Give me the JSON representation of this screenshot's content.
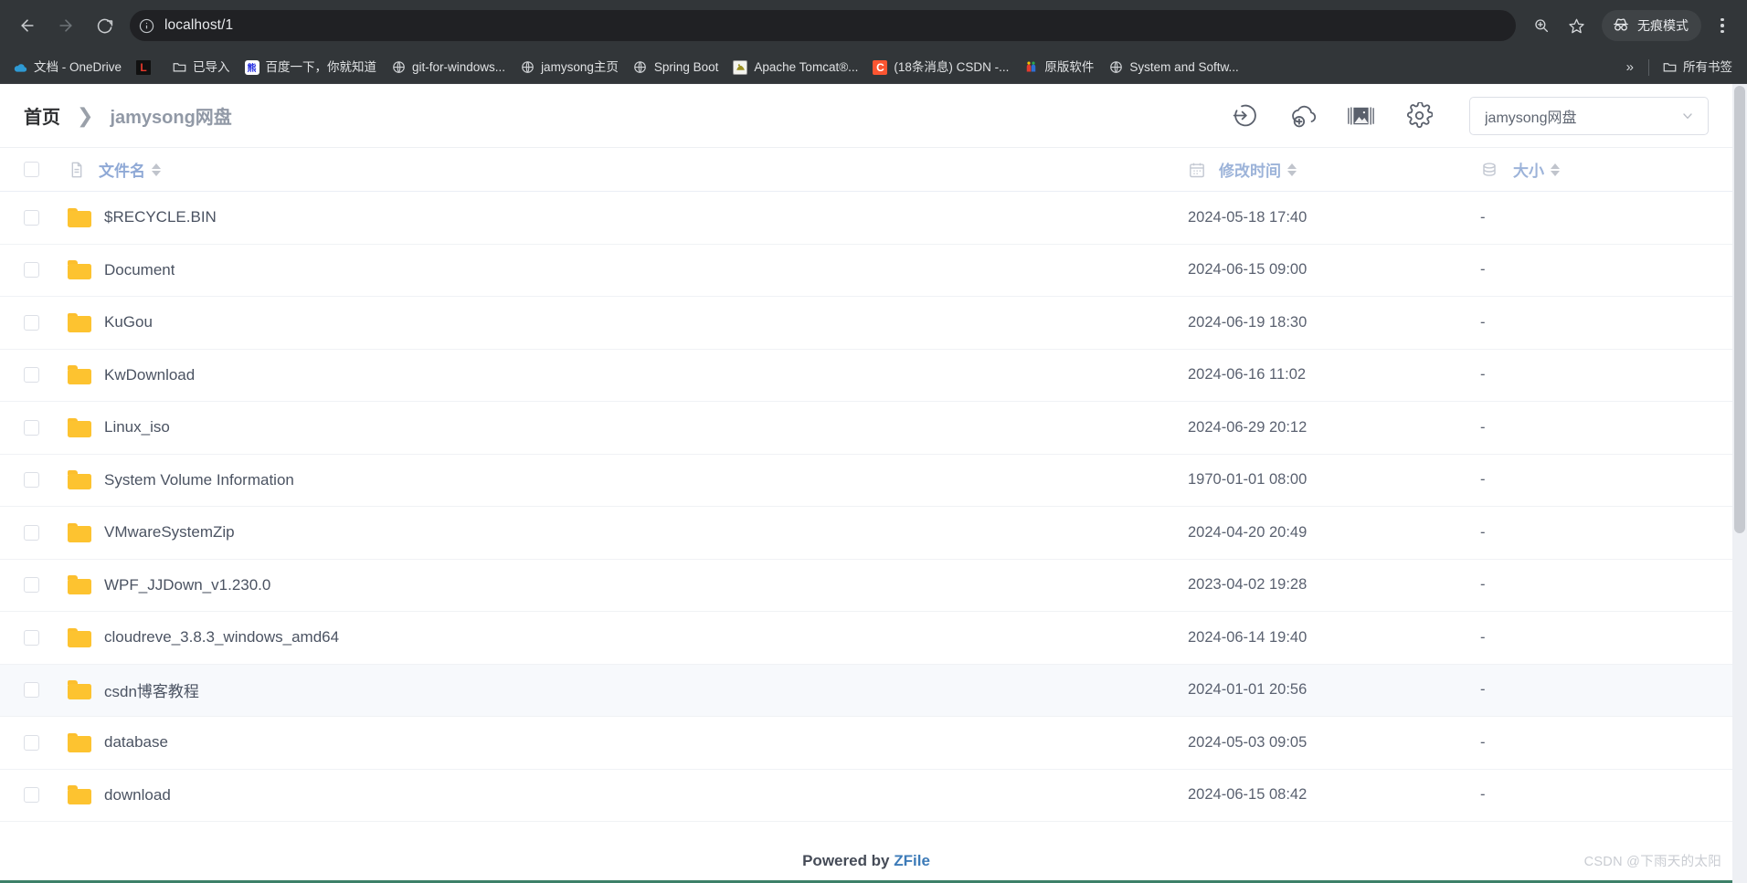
{
  "browser": {
    "back_label": "Back",
    "forward_label": "Forward",
    "reload_label": "Reload",
    "url": "localhost/1",
    "site_info_icon": "info-circle-icon",
    "zoom_icon": "zoom-in-icon",
    "bookmark_icon": "star-icon",
    "incognito_label": "无痕模式",
    "incognito_icon": "incognito-icon",
    "menu_icon": "three-dots-icon",
    "bookmarks": [
      {
        "label": "文档 - OneDrive",
        "icon": "onedrive-cloud-icon",
        "style": "fav-onedrive",
        "glyph": "☁"
      },
      {
        "label": "",
        "icon": "lenovo-l-icon",
        "style": "fav-l",
        "glyph": "L"
      },
      {
        "label": "已导入",
        "icon": "folder-icon",
        "style": "fav-folder",
        "glyph": "🗀"
      },
      {
        "label": "百度一下，你就知道",
        "icon": "baidu-icon",
        "style": "fav-baidu",
        "glyph": "百"
      },
      {
        "label": "git-for-windows...",
        "icon": "globe-icon",
        "style": "fav-globe",
        "glyph": "🌐"
      },
      {
        "label": "jamysong主页",
        "icon": "globe-icon",
        "style": "fav-globe",
        "glyph": "🌐"
      },
      {
        "label": "Spring Boot",
        "icon": "globe-icon",
        "style": "fav-globe",
        "glyph": "🌐"
      },
      {
        "label": "Apache Tomcat®...",
        "icon": "tomcat-icon",
        "style": "fav-tomcat",
        "glyph": "🐱"
      },
      {
        "label": "(18条消息) CSDN -...",
        "icon": "csdn-icon",
        "style": "fav-csdn",
        "glyph": "C"
      },
      {
        "label": "原版软件",
        "icon": "people-icon",
        "style": "fav-people",
        "glyph": "👬"
      },
      {
        "label": "System and Softw...",
        "icon": "globe-icon",
        "style": "fav-globe",
        "glyph": "🌐"
      }
    ],
    "overflow_label": "»",
    "all_bookmarks_label": "所有书签",
    "all_bookmarks_icon": "folder-icon"
  },
  "header": {
    "breadcrumb": {
      "home": "首页",
      "separator": "❯",
      "current": "jamysong网盘"
    },
    "actions": [
      {
        "name": "login-icon",
        "title": "登录"
      },
      {
        "name": "cloud-upload-icon",
        "title": "上传"
      },
      {
        "name": "gallery-image-icon",
        "title": "图片模式"
      },
      {
        "name": "settings-gear-icon",
        "title": "设置"
      }
    ],
    "storage_select": {
      "value": "jamysong网盘",
      "chevron_icon": "chevron-down-icon"
    }
  },
  "table": {
    "columns": [
      {
        "key": "name",
        "label": "文件名",
        "icon": "document-icon",
        "active": true
      },
      {
        "key": "time",
        "label": "修改时间",
        "icon": "calendar-icon",
        "active": false
      },
      {
        "key": "size",
        "label": "大小",
        "icon": "database-icon",
        "active": false
      }
    ],
    "rows": [
      {
        "name": "$RECYCLE.BIN",
        "time": "2024-05-18 17:40",
        "size": "-",
        "icon": "folder-icon",
        "highlight": false
      },
      {
        "name": "Document",
        "time": "2024-06-15 09:00",
        "size": "-",
        "icon": "folder-icon",
        "highlight": false
      },
      {
        "name": "KuGou",
        "time": "2024-06-19 18:30",
        "size": "-",
        "icon": "folder-icon",
        "highlight": false
      },
      {
        "name": "KwDownload",
        "time": "2024-06-16 11:02",
        "size": "-",
        "icon": "folder-icon",
        "highlight": false
      },
      {
        "name": "Linux_iso",
        "time": "2024-06-29 20:12",
        "size": "-",
        "icon": "folder-icon",
        "highlight": false
      },
      {
        "name": "System Volume Information",
        "time": "1970-01-01 08:00",
        "size": "-",
        "icon": "folder-icon",
        "highlight": false
      },
      {
        "name": "VMwareSystemZip",
        "time": "2024-04-20 20:49",
        "size": "-",
        "icon": "folder-icon",
        "highlight": false
      },
      {
        "name": "WPF_JJDown_v1.230.0",
        "time": "2023-04-02 19:28",
        "size": "-",
        "icon": "folder-icon",
        "highlight": false
      },
      {
        "name": "cloudreve_3.8.3_windows_amd64",
        "time": "2024-06-14 19:40",
        "size": "-",
        "icon": "folder-icon",
        "highlight": false
      },
      {
        "name": "csdn博客教程",
        "time": "2024-01-01 20:56",
        "size": "-",
        "icon": "folder-icon",
        "highlight": true
      },
      {
        "name": "database",
        "time": "2024-05-03 09:05",
        "size": "-",
        "icon": "folder-icon",
        "highlight": false
      },
      {
        "name": "download",
        "time": "2024-06-15 08:42",
        "size": "-",
        "icon": "folder-icon",
        "highlight": false
      }
    ]
  },
  "footer": {
    "powered_prefix": "Powered by ",
    "powered_link": "ZFile",
    "watermark": "CSDN @下雨天的太阳"
  }
}
